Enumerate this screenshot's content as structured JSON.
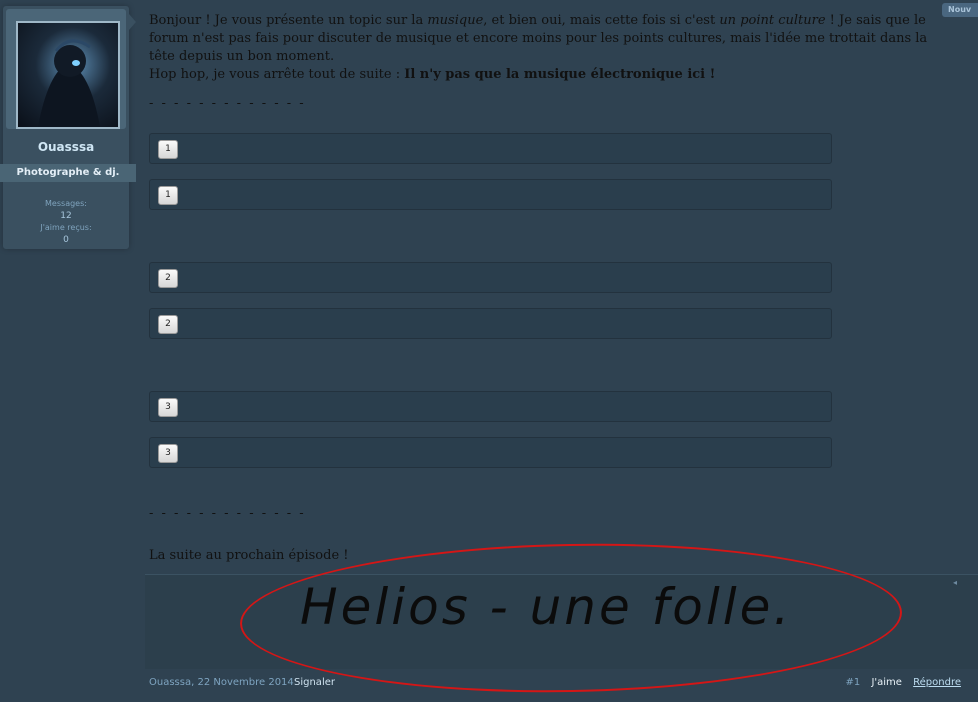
{
  "badge": "Nouv",
  "user": {
    "name": "Ouasssa",
    "title": "Photographe & dj.",
    "stats": {
      "messages_label": "Messages:",
      "messages_value": "12",
      "likes_label": "J'aime reçus:",
      "likes_value": "0"
    }
  },
  "post": {
    "intro_1": "Bonjour ! Je vous présente un topic sur la ",
    "intro_em1": "musique",
    "intro_2": ", et bien oui, mais cette fois si c'est ",
    "intro_em2": "un point culture",
    "intro_3": " ! Je sais que le forum n'est pas fais pour discuter de musique et encore moins pour les points cultures, mais l'idée me trottait dans la tête depuis un bon moment.",
    "line2_a": "Hop hop, je vous arrête tout de suite : ",
    "line2_b": "Il n'y pas que la musique électronique ici !",
    "separator": "- - - - - - - - - - - - -",
    "spoilers": [
      "1",
      "1",
      "2",
      "2",
      "3",
      "3"
    ],
    "ending": "La suite au prochain épisode !"
  },
  "signature": {
    "text": "Helios - une folle.",
    "toggle": "◂"
  },
  "footer": {
    "author_date": "Ouasssa, 22 Novembre 2014",
    "report": "Signaler",
    "post_number": "#1",
    "like": "J'aime",
    "reply": "Répondre"
  },
  "colors": {
    "background": "#2f4251",
    "annotation_circle": "#d41616"
  }
}
